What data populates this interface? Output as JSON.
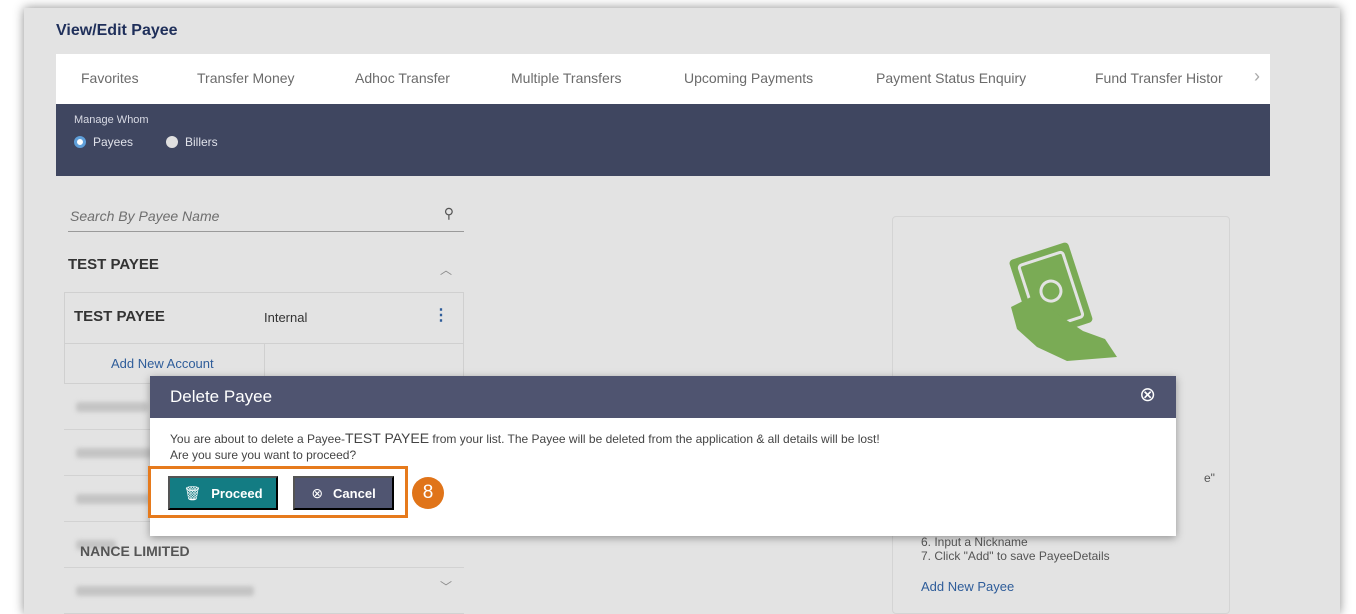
{
  "page_title": "View/Edit Payee",
  "tabs": [
    "Favorites",
    "Transfer Money",
    "Adhoc Transfer",
    "Multiple Transfers",
    "Upcoming Payments",
    "Payment Status Enquiry",
    "Fund Transfer Histor"
  ],
  "tab_next_icon": "chevron-right-icon",
  "manage_whom": {
    "label": "Manage Whom",
    "options": [
      {
        "label": "Payees",
        "selected": true
      },
      {
        "label": "Billers",
        "selected": false
      }
    ]
  },
  "search": {
    "placeholder": "Search By Payee Name",
    "icon": "search-icon"
  },
  "payee_group": {
    "name": "TEST PAYEE"
  },
  "payee_card": {
    "name": "TEST PAYEE",
    "type": "Internal",
    "add_account": "Add New Account"
  },
  "visible_row_text": "NANCE LIMITED",
  "info_card": {
    "quote_fragment": "e\"",
    "steps": [
      "6. Input a Nickname",
      "7. Click \"Add\" to save PayeeDetails"
    ],
    "add_payee_label": "Add New Payee"
  },
  "dialog": {
    "title": "Delete Payee",
    "message_prefix": "You are about to delete a Payee-",
    "payee_name": "TEST PAYEE",
    "message_suffix": " from your list. The Payee will be deleted from the application & all details will be lost!",
    "question": "Are you sure you want to proceed?",
    "proceed_label": "Proceed",
    "cancel_label": "Cancel"
  },
  "annotation": {
    "step_number": "8",
    "color": "#e07419"
  },
  "colors": {
    "nav_dark": "#3f4660",
    "dialog_header": "#4f5470",
    "proceed": "#137c83",
    "cancel": "#505571",
    "link": "#2f5d9a"
  }
}
